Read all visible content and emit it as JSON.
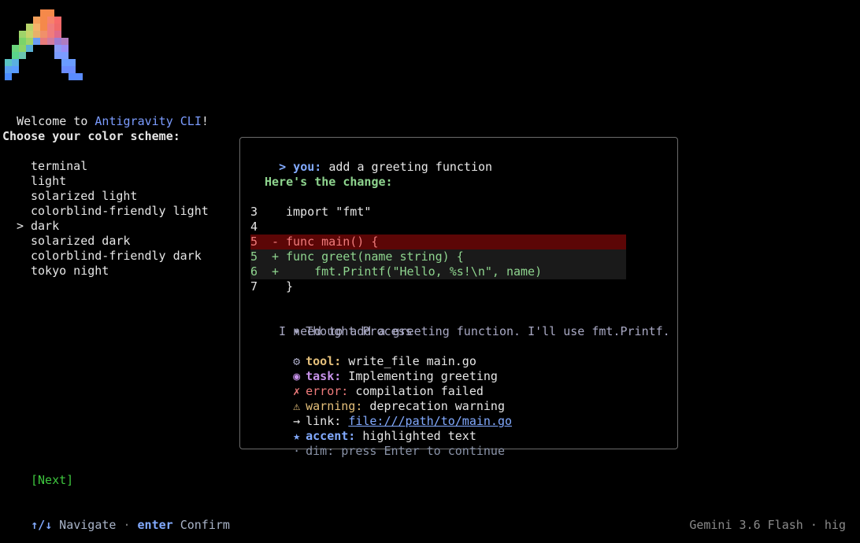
{
  "welcome": {
    "prefix": "Welcome to ",
    "app_name": "Antigravity CLI",
    "suffix": "!"
  },
  "prompt": "Choose your color scheme:",
  "menu": {
    "selected_index": 4,
    "caret": ">",
    "items": [
      "terminal",
      "light",
      "solarized light",
      "colorblind-friendly light",
      "dark",
      "solarized dark",
      "colorblind-friendly dark",
      "tokyo night"
    ]
  },
  "preview": {
    "user_prefix": "> you:",
    "user_message": " add a greeting function",
    "reply_heading": "Here's the change:",
    "code": [
      {
        "num": "3",
        "sym": "",
        "text": "import \"fmt\"",
        "kind": "ctx"
      },
      {
        "num": "4",
        "sym": "",
        "text": "",
        "kind": "ctx"
      },
      {
        "num": "5",
        "sym": "-",
        "text": "func main() {",
        "kind": "del"
      },
      {
        "num": "5",
        "sym": "+",
        "text": "func greet(name string) {",
        "kind": "add"
      },
      {
        "num": "6",
        "sym": "+",
        "text": "    fmt.Printf(\"Hello, %s!\\n\", name)",
        "kind": "add"
      },
      {
        "num": "7",
        "sym": "",
        "text": "}",
        "kind": "ctx"
      }
    ],
    "thought_toggle": "▾",
    "thought_title": "Thought Process",
    "thought_body": "I need to add a greeting function. I'll use fmt.Printf.",
    "tool": {
      "icon": "gear-icon",
      "glyph": "⚙",
      "label": "tool:",
      "value": " write_file main.go"
    },
    "task": {
      "icon": "task-circle-icon",
      "glyph": "◉",
      "label": "task:",
      "value": " Implementing greeting"
    },
    "error": {
      "icon": "error-x-icon",
      "glyph": "✗",
      "label": "error:",
      "value": " compilation failed"
    },
    "warning": {
      "icon": "warning-icon",
      "glyph": "⚠",
      "label": "warning:",
      "value": " deprecation warning"
    },
    "link": {
      "icon": "arrow-right-icon",
      "glyph": "→",
      "label": "link:",
      "value": "file:///path/to/main.go"
    },
    "accent": {
      "icon": "star-icon",
      "glyph": "★",
      "label": "accent:",
      "value": " highlighted text"
    },
    "dim": {
      "icon": "dot-icon",
      "glyph": "·",
      "text": "dim: press Enter to continue"
    }
  },
  "next_button": "[Next]",
  "nav_hint": {
    "nav_key": "↑/↓",
    "nav_label": " Navigate",
    "sep": " · ",
    "confirm_key": "enter",
    "confirm_label": " Confirm"
  },
  "status": "Gemini 3.6 Flash · hig",
  "colors": {
    "background": "#000000",
    "accent": "#7b9cff",
    "success": "#3ec63e",
    "diff_delete_bg": "#5c0606",
    "border": "#6b6b6b"
  }
}
